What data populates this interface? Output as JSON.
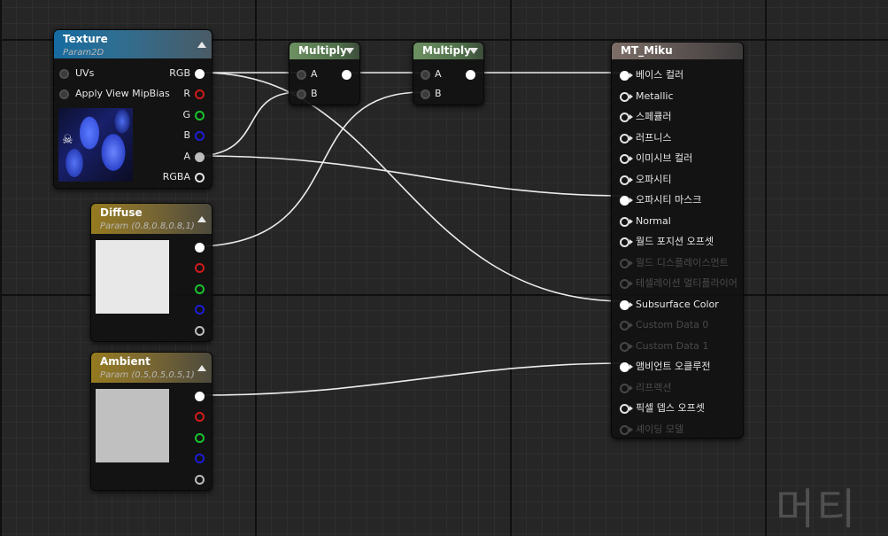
{
  "nodes": {
    "texture": {
      "title": "Texture",
      "subtitle": "Param2D",
      "inputs": [
        "UVs",
        "Apply View MipBias"
      ],
      "outputs": [
        "RGB",
        "R",
        "G",
        "B",
        "A",
        "RGBA"
      ]
    },
    "diffuse": {
      "title": "Diffuse",
      "subtitle": "Param (0.8,0.8,0.8,1)",
      "preview_color": "#e8e8e8"
    },
    "ambient": {
      "title": "Ambient",
      "subtitle": "Param (0.5,0.5,0.5,1)",
      "preview_color": "#c0c0c0"
    },
    "multiply1": {
      "title": "Multiply",
      "inputs": [
        "A",
        "B"
      ]
    },
    "multiply2": {
      "title": "Multiply",
      "inputs": [
        "A",
        "B"
      ]
    },
    "material": {
      "title": "MT_Miku",
      "inputs": [
        "베이스 컬러",
        "Metallic",
        "스페큘러",
        "러프니스",
        "이미시브 컬러",
        "오파시티",
        "오파시티 마스크",
        "Normal",
        "월드 포지션 오프셋",
        "월드 디스플레이스먼트",
        "테셀레이션 멀티플라이어",
        "Subsurface Color",
        "Custom Data 0",
        "Custom Data 1",
        "앰비언트 오클루전",
        "리프랙션",
        "픽셀 뎁스 오프셋",
        "셰이딩 모델"
      ]
    }
  },
  "watermark": "머티"
}
